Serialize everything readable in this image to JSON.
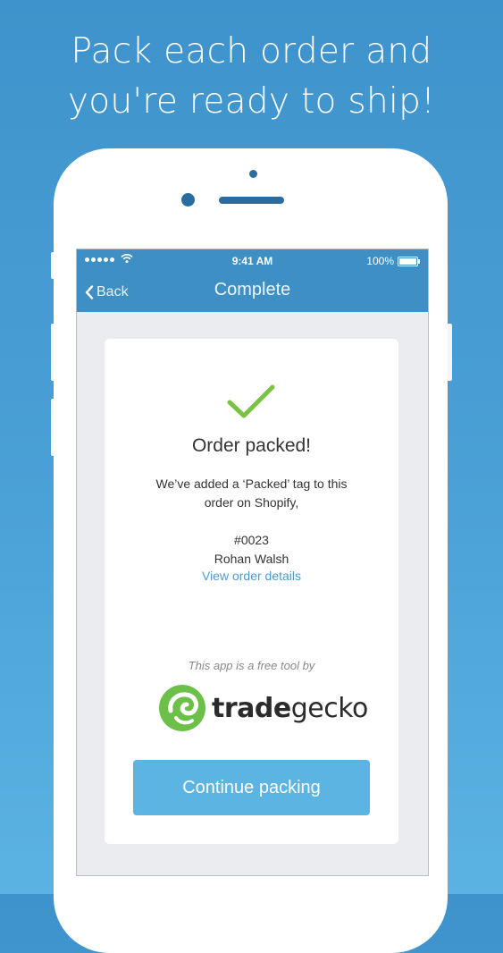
{
  "headline": {
    "line1": "Pack each order and",
    "line2": "you're ready to ship!"
  },
  "status_bar": {
    "signal_dots": 5,
    "time": "9:41 AM",
    "battery": "100%",
    "battery_level": 1.0
  },
  "nav": {
    "back_label": "Back",
    "title": "Complete"
  },
  "card": {
    "title": "Order packed!",
    "message_line1": "We’ve added a ‘Packed’ tag to this",
    "message_line2": "order on Shopify,",
    "order_number": "#0023",
    "customer_name": "Rohan Walsh",
    "view_details_link": "View order details",
    "free_tool_text": "This app is a free tool by",
    "brand_part1": "trade",
    "brand_part2": "gecko",
    "continue_button": "Continue packing"
  },
  "colors": {
    "background": "#4aa1d6",
    "nav_bar": "#3d8fc4",
    "check": "#7cc242",
    "link": "#4a9bd1",
    "button": "#5cb4e3",
    "brand_green": "#6cc04a"
  },
  "icons": [
    "wifi-icon",
    "battery-icon",
    "chevron-left-icon",
    "checkmark-icon",
    "tradegecko-logo-icon"
  ]
}
